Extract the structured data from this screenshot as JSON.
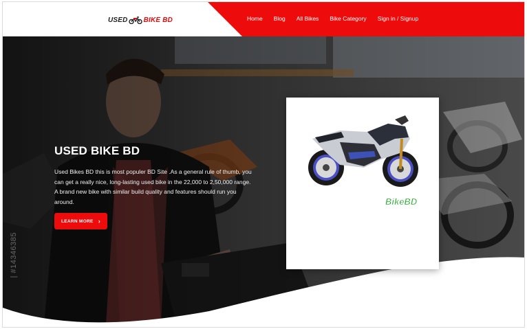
{
  "header": {
    "logo_used": "USED",
    "logo_bike": "BIKE BD",
    "nav": [
      "Home",
      "Blog",
      "All Bikes",
      "Bike Category",
      "Sign in / Signup"
    ]
  },
  "hero": {
    "title": "USED BIKE BD",
    "description": "Used Bikes BD this is most populer BD Site .As a general rule of thumb, you can get a really nice, long-lasting used bike in the 22,000 to 2,50,000 range. A brand new bike with similar build quality and features should run you around.",
    "button_label": "LEARN MORE",
    "watermark": "| #14346385",
    "card_logo": "BikeBD"
  },
  "colors": {
    "accent": "#ee0b0b",
    "logo_text": "#222222",
    "background": "#ffffff"
  },
  "icons": [
    "motorcycle-icon",
    "chevron-right-icon"
  ]
}
